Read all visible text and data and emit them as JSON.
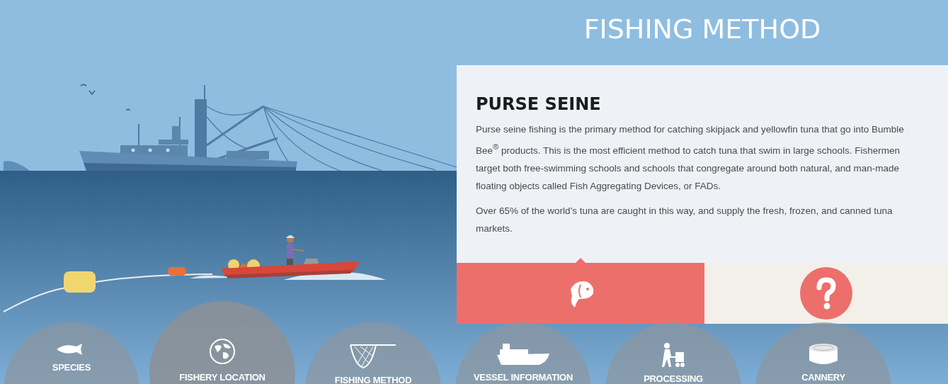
{
  "page_title": "FISHING METHOD",
  "panel": {
    "heading": "PURSE SEINE",
    "paragraphs": [
      "Purse seine fishing is the primary method for catching skipjack and yellowfin tuna that go into Bumble Bee$^{®}$ products. This is the most efficient method to catch tuna that swim in large schools. Fishermen target both free-swimming schools and schools that congregate around both natural, and man-made floating objects called Fish Aggregating Devices, or FADs.",
      "Over 65% of the world’s tuna are caught in this way, and supply the fresh, frozen, and canned tuna markets."
    ],
    "tabs": [
      {
        "kind": "fish",
        "selected": true
      },
      {
        "kind": "question",
        "selected": false
      }
    ]
  },
  "nav": [
    {
      "label": "SPECIES",
      "kind": "tuna",
      "selected": false
    },
    {
      "label": "FISHERY LOCATION",
      "kind": "globe",
      "selected": true
    },
    {
      "label": "FISHING METHOD",
      "kind": "net",
      "selected": false
    },
    {
      "label": "VESSEL INFORMATION",
      "kind": "vessel",
      "selected": false
    },
    {
      "label": "PROCESSING",
      "kind": "worker",
      "selected": false
    },
    {
      "label": "CANNERY",
      "kind": "can",
      "selected": false
    }
  ]
}
